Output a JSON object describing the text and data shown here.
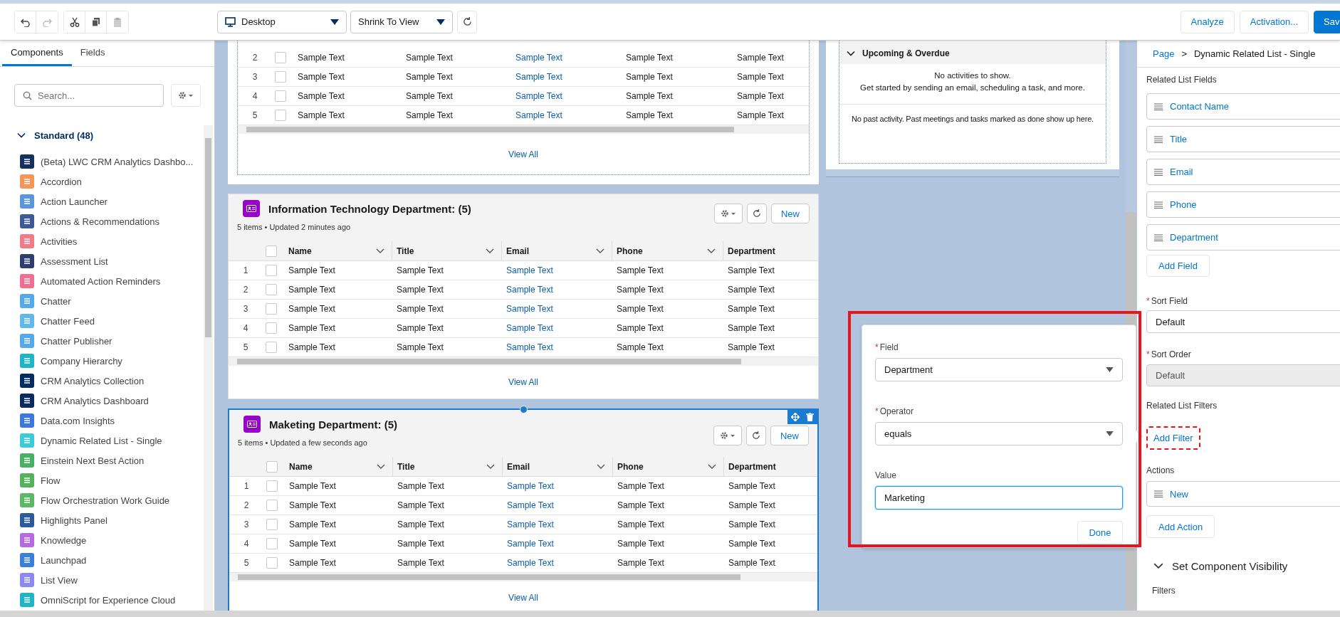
{
  "toolbar": {
    "device_select": {
      "value": "Desktop"
    },
    "view_select": {
      "value": "Shrink To View"
    },
    "buttons": [
      {
        "label": "Analyze",
        "kind": "neutral"
      },
      {
        "label": "Activation...",
        "kind": "neutral"
      },
      {
        "label": "Sav",
        "kind": "brand"
      }
    ]
  },
  "left_panel": {
    "tabs": [
      {
        "label": "Components",
        "selected": true
      },
      {
        "label": "Fields",
        "selected": false
      }
    ],
    "search": {
      "placeholder": "Search..."
    },
    "section": {
      "label": "Standard (48)",
      "expanded": true,
      "items": [
        {
          "label": "(Beta) LWC CRM Analytics Dashbo...",
          "color": "#16325c"
        },
        {
          "label": "Accordion",
          "color": "#f49756"
        },
        {
          "label": "Action Launcher",
          "color": "#5a95dd"
        },
        {
          "label": "Actions & Recommendations",
          "color": "#3e5a94"
        },
        {
          "label": "Activities",
          "color": "#f17b87"
        },
        {
          "label": "Assessment List",
          "color": "#2e3e6e"
        },
        {
          "label": "Automated Action Reminders",
          "color": "#f06f91"
        },
        {
          "label": "Chatter",
          "color": "#54a9e8"
        },
        {
          "label": "Chatter Feed",
          "color": "#62b7ed"
        },
        {
          "label": "Chatter Publisher",
          "color": "#54a9e8"
        },
        {
          "label": "Company Hierarchy",
          "color": "#1fb5c5"
        },
        {
          "label": "CRM Analytics Collection",
          "color": "#032d60"
        },
        {
          "label": "CRM Analytics Dashboard",
          "color": "#0b2a5e"
        },
        {
          "label": "Data.com Insights",
          "color": "#3a79dd"
        },
        {
          "label": "Dynamic Related List - Single",
          "color": "#3bcbd9"
        },
        {
          "label": "Einstein Next Best Action",
          "color": "#4bb066"
        },
        {
          "label": "Flow",
          "color": "#54b15c"
        },
        {
          "label": "Flow Orchestration Work Guide",
          "color": "#5cb865"
        },
        {
          "label": "Highlights Panel",
          "color": "#2d5a9a"
        },
        {
          "label": "Knowledge",
          "color": "#b66ae2"
        },
        {
          "label": "Launchpad",
          "color": "#3a7fdc"
        },
        {
          "label": "List View",
          "color": "#8c89f2"
        },
        {
          "label": "OmniScript for Experience Cloud",
          "color": "#1fb5c5"
        }
      ]
    }
  },
  "canvas": {
    "related_lists": [
      {
        "selected": false,
        "rows": [
          {
            "number": "2",
            "checked": false,
            "cells": [
              {
                "text": "Sample Text",
                "link": false
              },
              {
                "text": "Sample Text",
                "link": false
              },
              {
                "text": "Sample Text",
                "link": true
              },
              {
                "text": "Sample Text",
                "link": false
              },
              {
                "text": "Sample Text",
                "link": false
              }
            ]
          },
          {
            "number": "3",
            "checked": false,
            "cells": [
              {
                "text": "Sample Text",
                "link": false
              },
              {
                "text": "Sample Text",
                "link": false
              },
              {
                "text": "Sample Text",
                "link": true
              },
              {
                "text": "Sample Text",
                "link": false
              },
              {
                "text": "Sample Text",
                "link": false
              }
            ]
          },
          {
            "number": "4",
            "checked": false,
            "cells": [
              {
                "text": "Sample Text",
                "link": false
              },
              {
                "text": "Sample Text",
                "link": false
              },
              {
                "text": "Sample Text",
                "link": true
              },
              {
                "text": "Sample Text",
                "link": false
              },
              {
                "text": "Sample Text",
                "link": false
              }
            ]
          },
          {
            "number": "5",
            "checked": false,
            "cells": [
              {
                "text": "Sample Text",
                "link": false
              },
              {
                "text": "Sample Text",
                "link": false
              },
              {
                "text": "Sample Text",
                "link": true
              },
              {
                "text": "Sample Text",
                "link": false
              },
              {
                "text": "Sample Text",
                "link": false
              }
            ]
          }
        ],
        "view_all": "View All"
      },
      {
        "selected": false,
        "title": "Information Technology Department: (5)",
        "subtitle": "5 items • Updated 2 minutes ago",
        "new_button": "New",
        "select_all_checked": false,
        "columns": [
          {
            "label": "Name",
            "sortable": true
          },
          {
            "label": "Title",
            "sortable": true
          },
          {
            "label": "Email",
            "sortable": true
          },
          {
            "label": "Phone",
            "sortable": true
          },
          {
            "label": "Department",
            "sortable": false
          }
        ],
        "rows": [
          {
            "number": "1",
            "checked": false,
            "cells": [
              {
                "text": "Sample Text",
                "link": false
              },
              {
                "text": "Sample Text",
                "link": false
              },
              {
                "text": "Sample Text",
                "link": true
              },
              {
                "text": "Sample Text",
                "link": false
              },
              {
                "text": "Sample Text",
                "link": false
              }
            ]
          },
          {
            "number": "2",
            "checked": false,
            "cells": [
              {
                "text": "Sample Text",
                "link": false
              },
              {
                "text": "Sample Text",
                "link": false
              },
              {
                "text": "Sample Text",
                "link": true
              },
              {
                "text": "Sample Text",
                "link": false
              },
              {
                "text": "Sample Text",
                "link": false
              }
            ]
          },
          {
            "number": "3",
            "checked": false,
            "cells": [
              {
                "text": "Sample Text",
                "link": false
              },
              {
                "text": "Sample Text",
                "link": false
              },
              {
                "text": "Sample Text",
                "link": true
              },
              {
                "text": "Sample Text",
                "link": false
              },
              {
                "text": "Sample Text",
                "link": false
              }
            ]
          },
          {
            "number": "4",
            "checked": false,
            "cells": [
              {
                "text": "Sample Text",
                "link": false
              },
              {
                "text": "Sample Text",
                "link": false
              },
              {
                "text": "Sample Text",
                "link": true
              },
              {
                "text": "Sample Text",
                "link": false
              },
              {
                "text": "Sample Text",
                "link": false
              }
            ]
          },
          {
            "number": "5",
            "checked": false,
            "cells": [
              {
                "text": "Sample Text",
                "link": false
              },
              {
                "text": "Sample Text",
                "link": false
              },
              {
                "text": "Sample Text",
                "link": true
              },
              {
                "text": "Sample Text",
                "link": false
              },
              {
                "text": "Sample Text",
                "link": false
              }
            ]
          }
        ],
        "view_all": "View All"
      },
      {
        "selected": true,
        "title": "Maketing Department: (5)",
        "subtitle": "5 items • Updated a few seconds ago",
        "new_button": "New",
        "select_all_checked": false,
        "columns": [
          {
            "label": "Name",
            "sortable": true
          },
          {
            "label": "Title",
            "sortable": true
          },
          {
            "label": "Email",
            "sortable": true
          },
          {
            "label": "Phone",
            "sortable": true
          },
          {
            "label": "Department",
            "sortable": false
          }
        ],
        "rows": [
          {
            "number": "1",
            "checked": false,
            "cells": [
              {
                "text": "Sample Text",
                "link": false
              },
              {
                "text": "Sample Text",
                "link": false
              },
              {
                "text": "Sample Text",
                "link": true
              },
              {
                "text": "Sample Text",
                "link": false
              },
              {
                "text": "Sample Text",
                "link": false
              }
            ]
          },
          {
            "number": "2",
            "checked": false,
            "cells": [
              {
                "text": "Sample Text",
                "link": false
              },
              {
                "text": "Sample Text",
                "link": false
              },
              {
                "text": "Sample Text",
                "link": true
              },
              {
                "text": "Sample Text",
                "link": false
              },
              {
                "text": "Sample Text",
                "link": false
              }
            ]
          },
          {
            "number": "3",
            "checked": false,
            "cells": [
              {
                "text": "Sample Text",
                "link": false
              },
              {
                "text": "Sample Text",
                "link": false
              },
              {
                "text": "Sample Text",
                "link": true
              },
              {
                "text": "Sample Text",
                "link": false
              },
              {
                "text": "Sample Text",
                "link": false
              }
            ]
          },
          {
            "number": "4",
            "checked": false,
            "cells": [
              {
                "text": "Sample Text",
                "link": false
              },
              {
                "text": "Sample Text",
                "link": false
              },
              {
                "text": "Sample Text",
                "link": true
              },
              {
                "text": "Sample Text",
                "link": false
              },
              {
                "text": "Sample Text",
                "link": false
              }
            ]
          },
          {
            "number": "5",
            "checked": false,
            "cells": [
              {
                "text": "Sample Text",
                "link": false
              },
              {
                "text": "Sample Text",
                "link": false
              },
              {
                "text": "Sample Text",
                "link": true
              },
              {
                "text": "Sample Text",
                "link": false
              },
              {
                "text": "Sample Text",
                "link": false
              }
            ]
          }
        ],
        "view_all": "View All"
      }
    ],
    "activity": {
      "section": "Upcoming & Overdue",
      "expanded": true,
      "empty_title": "No activities to show.",
      "empty_text": "Get started by sending an email, scheduling a task, and more.",
      "past_text": "No past activity. Past meetings and tasks marked as done show up here."
    },
    "filter_popover": {
      "highlighted": true,
      "field": {
        "label": "Field",
        "required_mark": "*",
        "value": "Department"
      },
      "operator": {
        "label": "Operator",
        "required_mark": "*",
        "value": "equals"
      },
      "value": {
        "label": "Value",
        "value": "Marketing"
      },
      "done_button": "Done"
    }
  },
  "right_panel": {
    "breadcrumb": {
      "link": "Page",
      "separator": ">",
      "current": "Dynamic Related List - Single"
    },
    "fields": {
      "label": "Related List Fields",
      "items": [
        "Contact Name",
        "Title",
        "Email",
        "Phone",
        "Department"
      ],
      "add_button": "Add Field"
    },
    "sort_field": {
      "label": "Sort Field",
      "required_mark": "*",
      "value": "Default",
      "disabled": false
    },
    "sort_order": {
      "label": "Sort Order",
      "required_mark": "*",
      "value": "Default",
      "disabled": true
    },
    "filters": {
      "label": "Related List Filters",
      "add_button": "Add Filter",
      "highlighted": true
    },
    "actions": {
      "label": "Actions",
      "items": [
        "New"
      ],
      "add_button": "Add Action"
    },
    "visibility": {
      "label": "Set Component Visibility",
      "expanded": true,
      "filters_label": "Filters"
    }
  }
}
